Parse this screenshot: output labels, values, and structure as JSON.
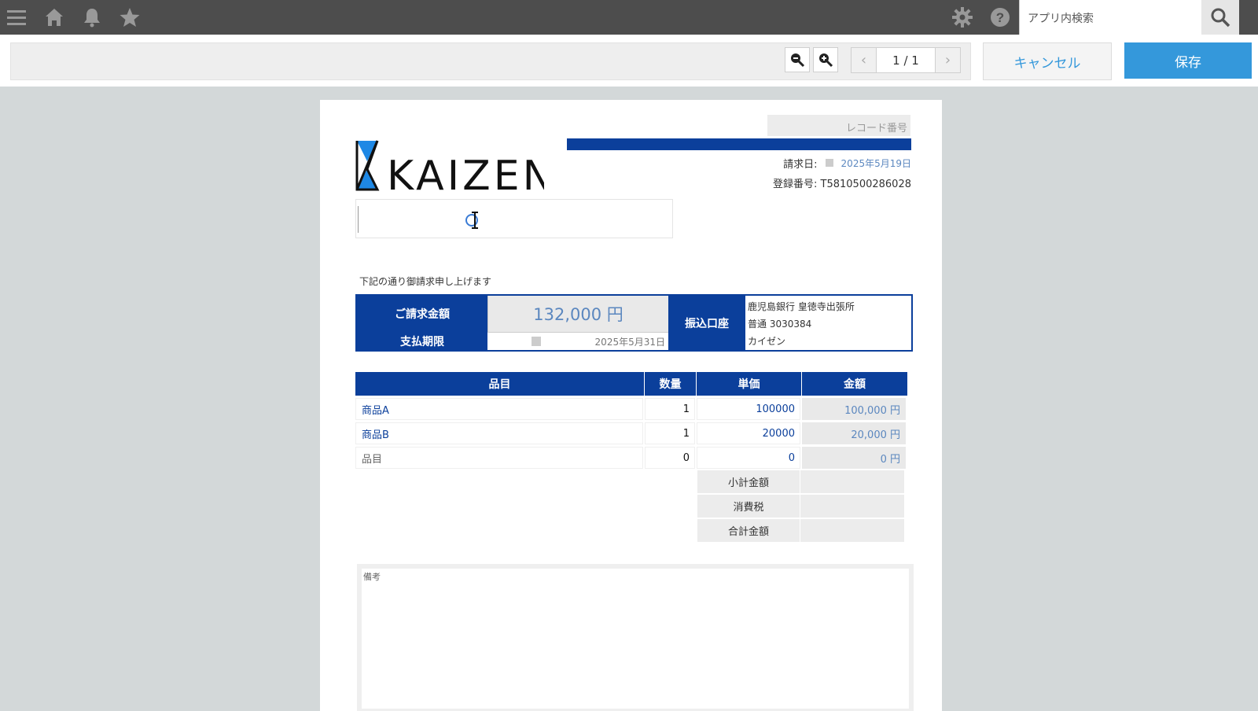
{
  "header": {
    "search_placeholder": "アプリ内検索"
  },
  "toolbar": {
    "page_indicator": "1 / 1",
    "cancel_label": "キャンセル",
    "save_label": "保存"
  },
  "invoice": {
    "record_no_label": "レコード番号",
    "invoice_date_label": "請求日:",
    "invoice_date": "2025年5月19日",
    "registration_label": "登録番号:",
    "registration_no": "T5810500286028",
    "logo_text": "KAIZEN",
    "intro_text": "下記の通り御請求申し上げます",
    "billing_amount_label": "ご請求金額",
    "billing_amount": "132,000 円",
    "due_label": "支払期限",
    "due_date": "2025年5月31日",
    "bank_label": "振込口座",
    "bank_lines": [
      "鹿児島銀行 皇徳寺出張所",
      "普通 3030384",
      "カイゼン"
    ],
    "table_headers": [
      "品目",
      "数量",
      "単価",
      "金額"
    ],
    "rows": [
      {
        "item": "商品A",
        "qty": "1",
        "price": "100000",
        "amount": "100,000 円"
      },
      {
        "item": "商品B",
        "qty": "1",
        "price": "20000",
        "amount": "20,000 円"
      },
      {
        "item": "品目",
        "qty": "0",
        "price": "0",
        "amount": "0 円"
      }
    ],
    "subtotal_label": "小計金額",
    "tax_label": "消費税",
    "total_label": "合計金額",
    "notes_label": "備考"
  },
  "colors": {
    "primary": "#0b3f9b",
    "accent": "#3498db",
    "topbar": "#4d4d4d"
  },
  "icons": [
    "menu-icon",
    "home-icon",
    "bell-icon",
    "star-icon",
    "gear-icon",
    "help-icon",
    "search-icon",
    "zoom-out-icon",
    "zoom-in-icon",
    "calendar-icon"
  ]
}
